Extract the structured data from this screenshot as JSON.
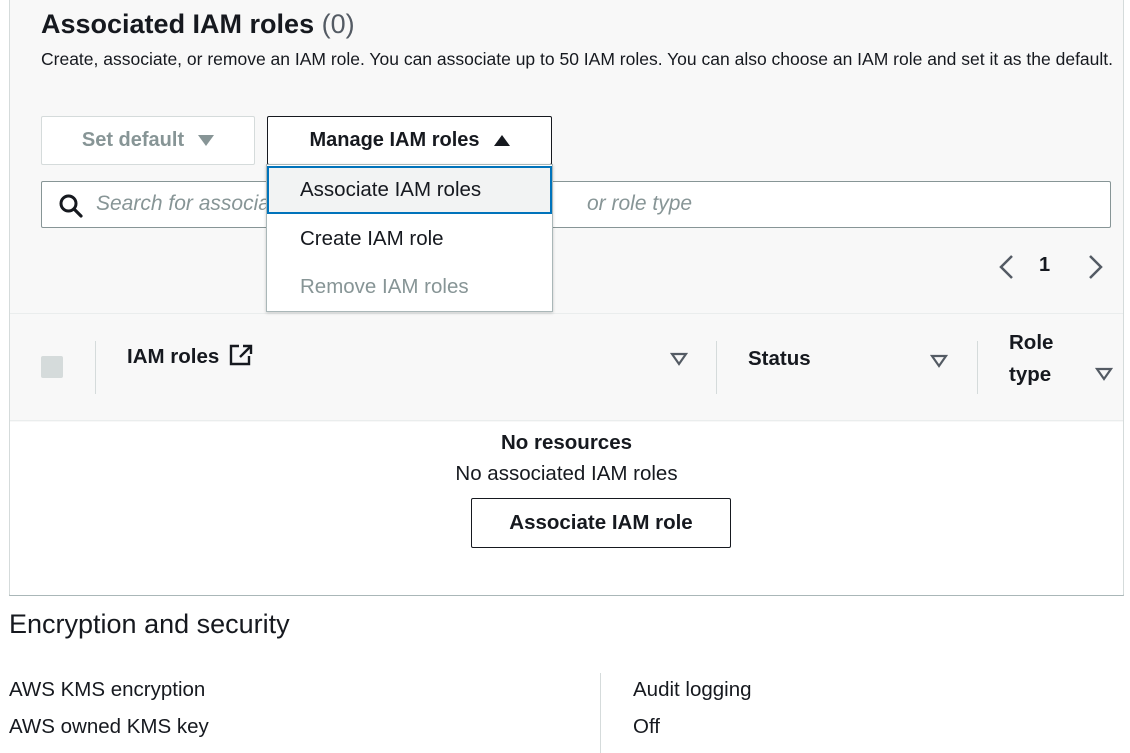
{
  "iam_panel": {
    "title": "Associated IAM roles",
    "count": "(0)",
    "description": "Create, associate, or remove an IAM role. You can associate up to 50 IAM roles. You can also choose an IAM role and set it as the default.",
    "set_default_label": "Set default",
    "manage_label": "Manage IAM roles",
    "search_placeholder": "Search for associa",
    "search_placeholder_tail": "or role type",
    "pagination": {
      "current_page": "1"
    },
    "table": {
      "columns": [
        "IAM roles",
        "Status",
        "Role type"
      ],
      "role_type_line1": "Role",
      "role_type_line2": "type"
    },
    "empty_state": {
      "title": "No resources",
      "subtitle": "No associated IAM roles",
      "button_label": "Associate IAM role"
    },
    "dropdown": {
      "items": [
        {
          "label": "Associate IAM roles",
          "state": "highlighted"
        },
        {
          "label": "Create IAM role",
          "state": "enabled"
        },
        {
          "label": "Remove IAM roles",
          "state": "disabled"
        }
      ]
    }
  },
  "encryption": {
    "title": "Encryption and security",
    "kms_label": "AWS KMS encryption",
    "kms_value": "AWS owned KMS key",
    "audit_label": "Audit logging",
    "audit_value": "Off"
  },
  "colors": {
    "focus_blue": "#0073bb",
    "text_dark": "#16191f",
    "text_disabled": "#879596",
    "panel_bg": "#f8f8f8"
  }
}
